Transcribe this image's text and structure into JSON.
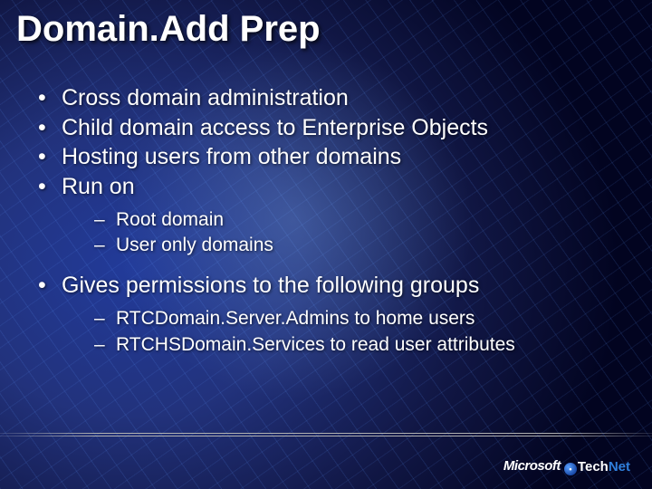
{
  "title": "Domain.Add Prep",
  "bullets": {
    "b0": "Cross domain administration",
    "b1": "Child domain access to Enterprise Objects",
    "b2": "Hosting users from other domains",
    "b3": "Run on",
    "b3_subs": {
      "s0": "Root domain",
      "s1": "User only domains"
    },
    "b4": "Gives permissions to the following groups",
    "b4_subs": {
      "s0": "RTCDomain.Server.Admins to home users",
      "s1": "RTCHSDomain.Services to read user attributes"
    }
  },
  "footer": {
    "brand": "Microsoft",
    "product_a": "Tech",
    "product_b": "Net",
    "dot_glyph": "•"
  }
}
